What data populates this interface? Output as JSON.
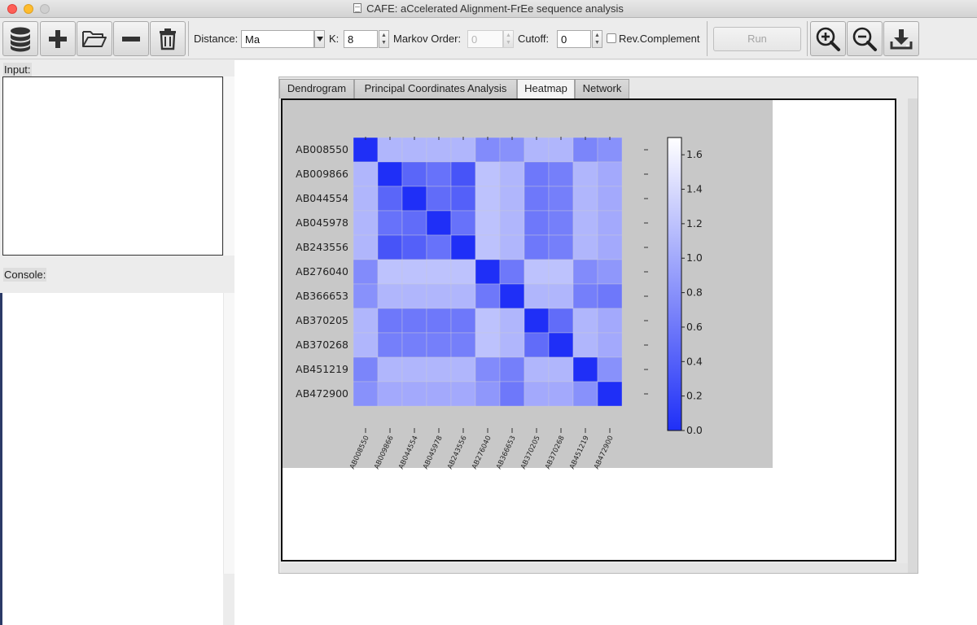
{
  "window": {
    "title": "CAFE: aCcelerated Alignment-FrEe sequence analysis"
  },
  "toolbar": {
    "buttons": [
      {
        "name": "database-button",
        "icon": "database-icon"
      },
      {
        "name": "add-button",
        "icon": "plus-icon"
      },
      {
        "name": "open-folder-button",
        "icon": "folder-open-icon"
      },
      {
        "name": "remove-button",
        "icon": "minus-icon"
      },
      {
        "name": "delete-button",
        "icon": "trash-icon"
      }
    ],
    "distance_label": "Distance:",
    "distance_value": "Ma",
    "k_label": "K:",
    "k_value": "8",
    "markov_label": "Markov Order:",
    "markov_value": "0",
    "cutoff_label": "Cutoff:",
    "cutoff_value": "0",
    "revcomp_label": "Rev.Complement",
    "revcomp_checked": false,
    "run_label": "Run",
    "right_buttons": [
      {
        "name": "zoom-in-button",
        "icon": "zoom-in-icon"
      },
      {
        "name": "zoom-out-button",
        "icon": "zoom-out-icon"
      },
      {
        "name": "download-button",
        "icon": "download-icon"
      }
    ]
  },
  "left": {
    "input_label": "Input:",
    "console_label": "Console:"
  },
  "tabs": [
    {
      "label": "Dendrogram",
      "active": false
    },
    {
      "label": "Principal Coordinates Analysis",
      "active": false
    },
    {
      "label": "Heatmap",
      "active": true
    },
    {
      "label": "Network",
      "active": false
    }
  ],
  "chart_data": {
    "type": "heatmap",
    "title": "",
    "xlabel": "",
    "ylabel": "",
    "labels": [
      "AB008550",
      "AB009866",
      "AB044554",
      "AB045978",
      "AB243556",
      "AB276040",
      "AB366653",
      "AB370205",
      "AB370268",
      "AB451219",
      "AB472900"
    ],
    "matrix": [
      [
        0.0,
        1.1,
        1.1,
        1.1,
        1.1,
        0.75,
        0.8,
        1.1,
        1.1,
        0.7,
        0.8
      ],
      [
        1.1,
        0.0,
        0.45,
        0.55,
        0.3,
        1.2,
        1.1,
        0.6,
        0.65,
        1.1,
        1.0
      ],
      [
        1.1,
        0.45,
        0.0,
        0.5,
        0.4,
        1.2,
        1.1,
        0.6,
        0.65,
        1.1,
        1.0
      ],
      [
        1.1,
        0.55,
        0.5,
        0.0,
        0.55,
        1.2,
        1.1,
        0.6,
        0.65,
        1.1,
        1.0
      ],
      [
        1.1,
        0.3,
        0.4,
        0.55,
        0.0,
        1.2,
        1.1,
        0.6,
        0.65,
        1.1,
        1.0
      ],
      [
        0.75,
        1.2,
        1.2,
        1.2,
        1.2,
        0.0,
        0.6,
        1.2,
        1.2,
        0.75,
        0.85
      ],
      [
        0.8,
        1.1,
        1.1,
        1.1,
        1.1,
        0.6,
        0.0,
        1.1,
        1.1,
        0.65,
        0.6
      ],
      [
        1.1,
        0.6,
        0.6,
        0.6,
        0.6,
        1.2,
        1.1,
        0.0,
        0.5,
        1.1,
        1.0
      ],
      [
        1.1,
        0.65,
        0.65,
        0.65,
        0.65,
        1.2,
        1.1,
        0.5,
        0.0,
        1.1,
        1.0
      ],
      [
        0.7,
        1.1,
        1.1,
        1.1,
        1.1,
        0.75,
        0.65,
        1.1,
        1.1,
        0.0,
        0.8
      ],
      [
        0.8,
        1.0,
        1.0,
        1.0,
        1.0,
        0.85,
        0.6,
        1.0,
        1.0,
        0.8,
        0.0
      ]
    ],
    "vmin": 0.0,
    "vmax": 1.7,
    "colorbar_ticks": [
      "0.0",
      "0.2",
      "0.4",
      "0.6",
      "0.8",
      "1.0",
      "1.2",
      "1.4",
      "1.6"
    ],
    "colormap": {
      "low": "#1f2ff7",
      "high": "#ffffff"
    },
    "background": "#c8c8c8"
  }
}
